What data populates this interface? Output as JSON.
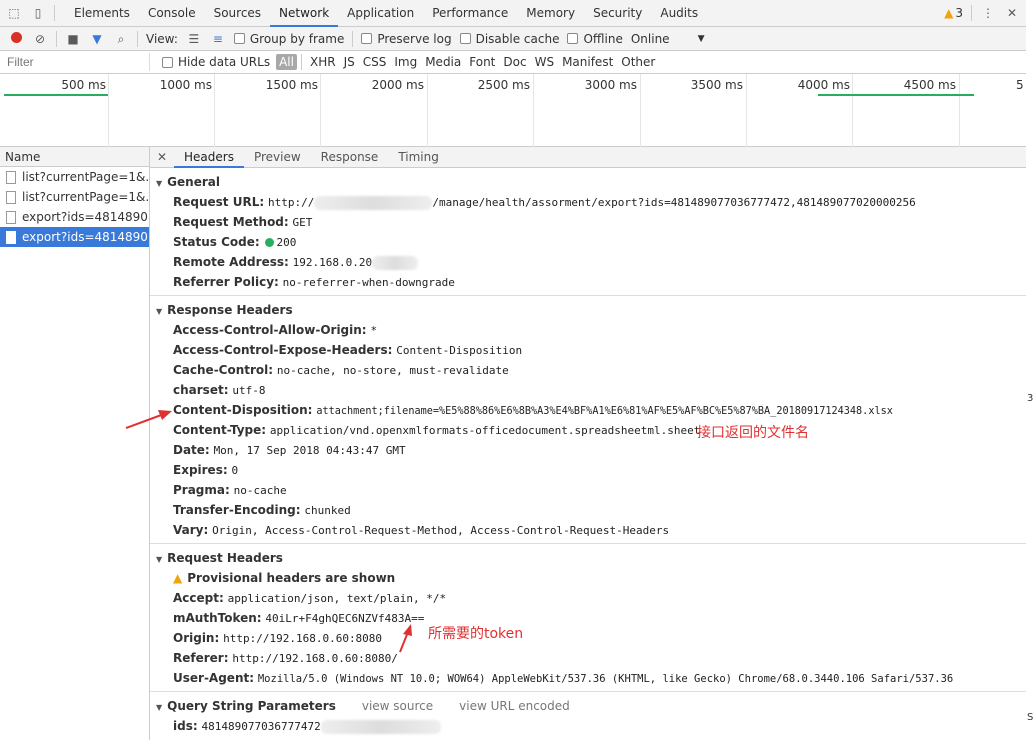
{
  "tabs": [
    "Elements",
    "Console",
    "Sources",
    "Network",
    "Application",
    "Performance",
    "Memory",
    "Security",
    "Audits"
  ],
  "warnings": "3",
  "toolbar": {
    "view": "View:",
    "group_by_frame": "Group by frame",
    "preserve_log": "Preserve log",
    "disable_cache": "Disable cache",
    "offline": "Offline",
    "online": "Online"
  },
  "filter": {
    "placeholder": "Filter",
    "hide_data_urls": "Hide data URLs",
    "types": [
      "All",
      "XHR",
      "JS",
      "CSS",
      "Img",
      "Media",
      "Font",
      "Doc",
      "WS",
      "Manifest",
      "Other"
    ]
  },
  "timeline": {
    "ticks": [
      "500 ms",
      "1000 ms",
      "1500 ms",
      "2000 ms",
      "2500 ms",
      "3000 ms",
      "3500 ms",
      "4000 ms",
      "4500 ms",
      "5"
    ]
  },
  "requests": {
    "header": "Name",
    "items": [
      "list?currentPage=1&...",
      "list?currentPage=1&...",
      "export?ids=4814890...",
      "export?ids=4814890..."
    ]
  },
  "detail_tabs": [
    "Headers",
    "Preview",
    "Response",
    "Timing"
  ],
  "general": {
    "title": "General",
    "rows": [
      {
        "k": "Request URL:",
        "v": "http://",
        "v2": "/manage/health/assorment/export?ids=481489077036777472,481489077020000256"
      },
      {
        "k": "Request Method:",
        "v": "GET"
      },
      {
        "k": "Status Code:",
        "v": "200"
      },
      {
        "k": "Remote Address:",
        "v": "192.168.0.20"
      },
      {
        "k": "Referrer Policy:",
        "v": "no-referrer-when-downgrade"
      }
    ]
  },
  "response_headers": {
    "title": "Response Headers",
    "rows": [
      {
        "k": "Access-Control-Allow-Origin:",
        "v": "*"
      },
      {
        "k": "Access-Control-Expose-Headers:",
        "v": "Content-Disposition"
      },
      {
        "k": "Cache-Control:",
        "v": "no-cache, no-store, must-revalidate"
      },
      {
        "k": "charset:",
        "v": "utf-8"
      },
      {
        "k": "Content-Disposition:",
        "v": "attachment;filename=%E5%88%86%E6%8B%A3%E4%BF%A1%E6%81%AF%E5%AF%BC%E5%87%BA_20180917124348.xlsx"
      },
      {
        "k": "Content-Type:",
        "v": "application/vnd.openxmlformats-officedocument.spreadsheetml.sheet"
      },
      {
        "k": "Date:",
        "v": "Mon, 17 Sep 2018 04:43:47 GMT"
      },
      {
        "k": "Expires:",
        "v": "0"
      },
      {
        "k": "Pragma:",
        "v": "no-cache"
      },
      {
        "k": "Transfer-Encoding:",
        "v": "chunked"
      },
      {
        "k": "Vary:",
        "v": "Origin, Access-Control-Request-Method, Access-Control-Request-Headers"
      }
    ]
  },
  "request_headers": {
    "title": "Request Headers",
    "provisional": "Provisional headers are shown",
    "rows": [
      {
        "k": "Accept:",
        "v": "application/json, text/plain, */*"
      },
      {
        "k": "mAuthToken:",
        "v": "40iLr+F4ghQEC6NZVf483A=="
      },
      {
        "k": "Origin:",
        "v": "http://192.168.0.60:8080"
      },
      {
        "k": "Referer:",
        "v": "http://192.168.0.60:8080/"
      },
      {
        "k": "User-Agent:",
        "v": "Mozilla/5.0 (Windows NT 10.0; WOW64) AppleWebKit/537.36 (KHTML, like Gecko) Chrome/68.0.3440.106 Safari/537.36"
      }
    ]
  },
  "query": {
    "title": "Query String Parameters",
    "view_source": "view source",
    "view_encoded": "view URL encoded",
    "k": "ids:",
    "v": "481489077036777472"
  },
  "annotations": {
    "filename": "接口返回的文件名",
    "token": "所需要的token"
  },
  "colors": {
    "accent": "#3879d9",
    "annotation": "#e03131",
    "status_ok": "#27ae60"
  }
}
